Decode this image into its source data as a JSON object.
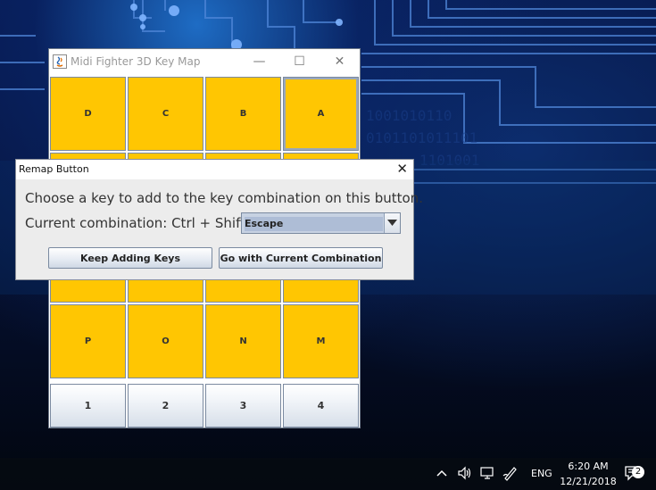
{
  "main_window": {
    "title": "Midi Fighter 3D Key Map",
    "controls": {
      "minimize": "—",
      "maximize": "☐",
      "close": "✕"
    },
    "key_cells": [
      {
        "label": "D"
      },
      {
        "label": "C"
      },
      {
        "label": "B"
      },
      {
        "label": "A"
      },
      {
        "label": ""
      },
      {
        "label": ""
      },
      {
        "label": ""
      },
      {
        "label": ""
      },
      {
        "label": ""
      },
      {
        "label": ""
      },
      {
        "label": ""
      },
      {
        "label": ""
      },
      {
        "label": "P"
      },
      {
        "label": "O"
      },
      {
        "label": "N"
      },
      {
        "label": "M"
      }
    ],
    "bank_buttons": [
      {
        "label": "1"
      },
      {
        "label": "2"
      },
      {
        "label": "3"
      },
      {
        "label": "4"
      }
    ]
  },
  "dialog": {
    "title": "Remap Button",
    "close": "✕",
    "prompt": "Choose a key to add to the key combination on this button.",
    "combination_label": "Current combination: Ctrl + Shift +",
    "selected_key": "Escape",
    "keep_button": "Keep Adding Keys",
    "go_button": "Go with Current Combination"
  },
  "taskbar": {
    "language": "ENG",
    "time": "6:20 AM",
    "date": "12/21/2018",
    "notification_count": "2"
  },
  "colors": {
    "key_cell": "#ffc602",
    "dialog_bg": "#ececec",
    "select_highlight": "#aebdd6"
  }
}
